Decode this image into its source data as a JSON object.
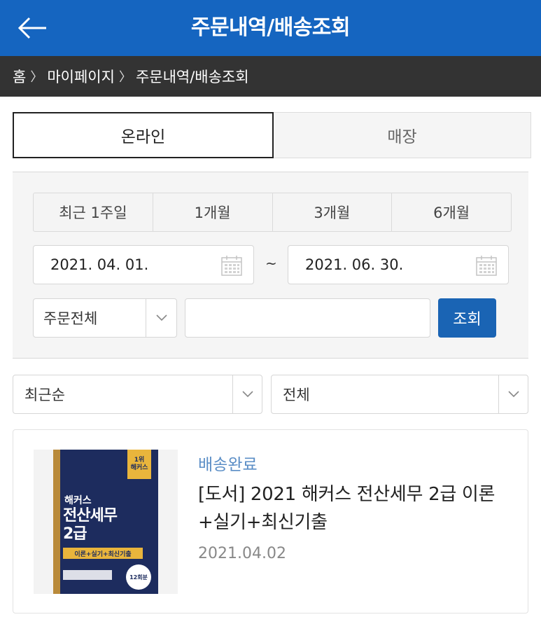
{
  "header": {
    "title": "주문내역/배송조회",
    "back_icon": "arrow-left-icon",
    "background": "#1565c0"
  },
  "breadcrumb": {
    "items": [
      "홈",
      "마이페이지",
      "주문내역/배송조회"
    ],
    "separator_icon": "chevron-right-icon"
  },
  "tabs": [
    {
      "label": "온라인",
      "selected": true
    },
    {
      "label": "매장",
      "selected": false
    }
  ],
  "filter": {
    "periods": [
      "최근 1주일",
      "1개월",
      "3개월",
      "6개월"
    ],
    "start_date": "2021. 04. 01.",
    "end_date": "2021. 06. 30.",
    "date_separator": "~",
    "calendar_icon": "calendar-icon",
    "order_type": {
      "selected": "주문전체"
    },
    "keyword": {
      "value": "",
      "placeholder": ""
    },
    "search_label": "조회",
    "accent": "#1a64b4"
  },
  "list_controls": {
    "sort": {
      "selected": "최근순"
    },
    "status": {
      "selected": "전체"
    },
    "dropdown_icon": "chevron-down-icon"
  },
  "orders": [
    {
      "status": "배송완료",
      "title": "[도서] 2021 해커스 전산세무 2급 이론+실기+최신기출",
      "date": "2021.04.02",
      "status_color": "#5b8ec6",
      "cover": {
        "badge_top": "1위",
        "badge_bottom": "해커스",
        "brand": "해커스",
        "title_line1": "전산세무",
        "title_line2": "2급",
        "subtitle": "이론+실기+최신기출",
        "seal": "12회분"
      }
    }
  ]
}
